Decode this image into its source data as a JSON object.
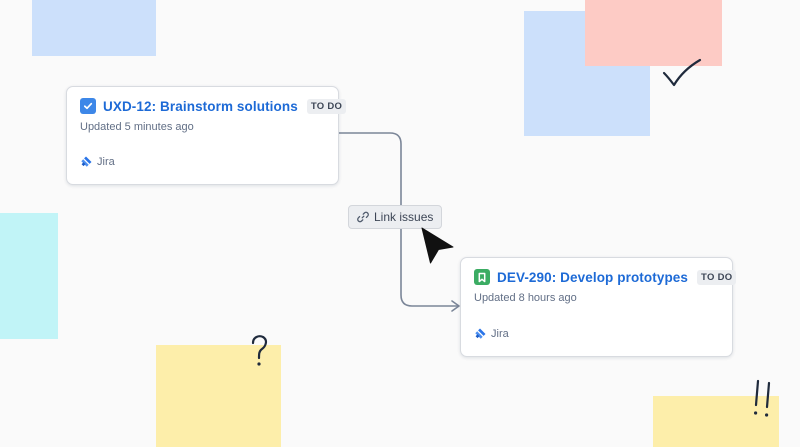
{
  "colors": {
    "sticky_blue": "#cce0fb",
    "sticky_pink": "#fdcbc5",
    "sticky_cyan": "#c1f4f7",
    "sticky_yellow": "#fdeeaa",
    "link_text": "#1d6ad6",
    "connector": "#7b8698",
    "task_icon": "#3d87e8",
    "story_icon": "#3bac63",
    "jira_logo": "#2a74e8"
  },
  "cards": [
    {
      "key_title": "UXD-12: Brainstorm solutions",
      "status": "TO DO",
      "updated": "Updated 5 minutes ago",
      "source": "Jira",
      "type_icon": "checkbox-icon"
    },
    {
      "key_title": "DEV-290: Develop prototypes",
      "status": "TO DO",
      "updated": "Updated 8 hours ago",
      "source": "Jira",
      "type_icon": "bookmark-icon"
    }
  ],
  "link_button": {
    "label": "Link issues",
    "icon": "link-icon"
  },
  "doodles": {
    "question": "?",
    "exclaim": "!!"
  }
}
